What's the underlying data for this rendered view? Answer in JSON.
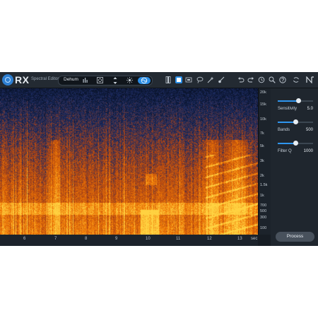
{
  "app": {
    "name": "RX",
    "subtitle": "Spectral Editor",
    "brand_color": "#2e7fd1",
    "accent_color": "#2b8ee6"
  },
  "toolbar": {
    "module_name": "Dehum",
    "module_icons": [
      "bars-icon",
      "compass-icon",
      "arrows-icon",
      "sun-icon",
      "wave-icon"
    ],
    "tools": [
      "vertical-bar-icon",
      "square-select-icon",
      "frame-icon",
      "lasso-icon",
      "magic-wand-icon",
      "brush-icon",
      "undo-icon",
      "redo-icon",
      "history-icon",
      "zoom-icon",
      "help-icon",
      "spin-icon",
      "izotope-logo"
    ]
  },
  "frequency_axis": {
    "labels": [
      "20k",
      "15k",
      "10k",
      "7k",
      "5k",
      "3k",
      "2k",
      "1.5k",
      "1k",
      "700",
      "500",
      "300",
      "100"
    ]
  },
  "time_axis": {
    "labels": [
      "6",
      "7",
      "8",
      "9",
      "10",
      "11",
      "12",
      "13"
    ],
    "unit": "sec"
  },
  "panel": {
    "sensitivity": {
      "label": "Sensitivity",
      "value": "5.0",
      "level": 0.58
    },
    "bands": {
      "label": "Bands",
      "value": "500",
      "level": 0.5
    },
    "filter_q": {
      "label": "Filter Q",
      "value": "1000",
      "level": 0.5
    },
    "process_label": "Process"
  }
}
